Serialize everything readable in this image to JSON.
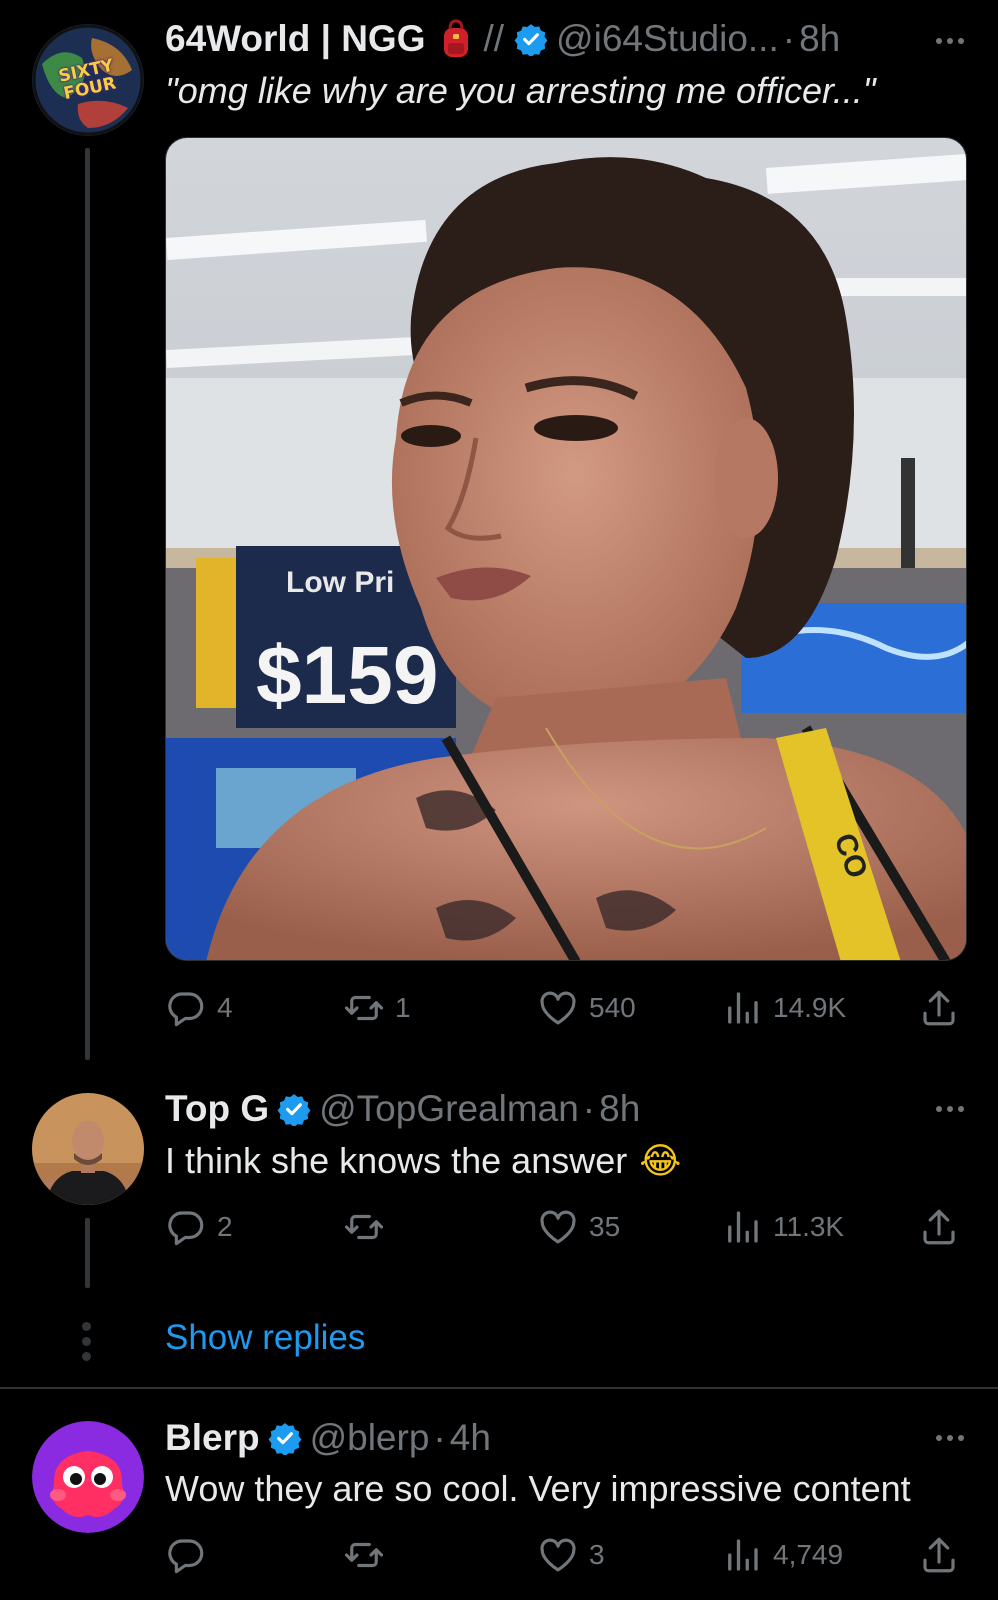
{
  "tweets": [
    {
      "name": "64World | NGG",
      "name_separator": "//",
      "handle": "@i64Studio...",
      "dot": "·",
      "time": "8h",
      "text": "\"omg like why are you arresting me officer...\"",
      "avatar_text": "SIXTY FOUR",
      "media": {
        "sign_small": "Low Pri",
        "sign_price": "$159",
        "tag_text": "CO"
      },
      "stats": {
        "replies": "4",
        "retweets": "1",
        "likes": "540",
        "views": "14.9K"
      }
    },
    {
      "name": "Top G",
      "handle": "@TopGrealman",
      "dot": "·",
      "time": "8h",
      "text": "I think she knows the answer",
      "emoji": "😂",
      "stats": {
        "replies": "2",
        "retweets": "",
        "likes": "35",
        "views": "11.3K"
      }
    },
    {
      "name": "Blerp",
      "handle": "@blerp",
      "dot": "·",
      "time": "4h",
      "text": "Wow they are so cool. Very impressive content",
      "stats": {
        "replies": "",
        "retweets": "",
        "likes": "3",
        "views": "4,749"
      }
    }
  ],
  "show_replies": "Show replies",
  "colors": {
    "background": "#000000",
    "text": "#e7e9ea",
    "muted": "#71767b",
    "accent": "#1d9bf0",
    "border": "#2f3336"
  },
  "icons": [
    "reply-icon",
    "retweet-icon",
    "like-icon",
    "views-icon",
    "share-icon",
    "verified-icon",
    "backpack-icon",
    "more-icon"
  ]
}
